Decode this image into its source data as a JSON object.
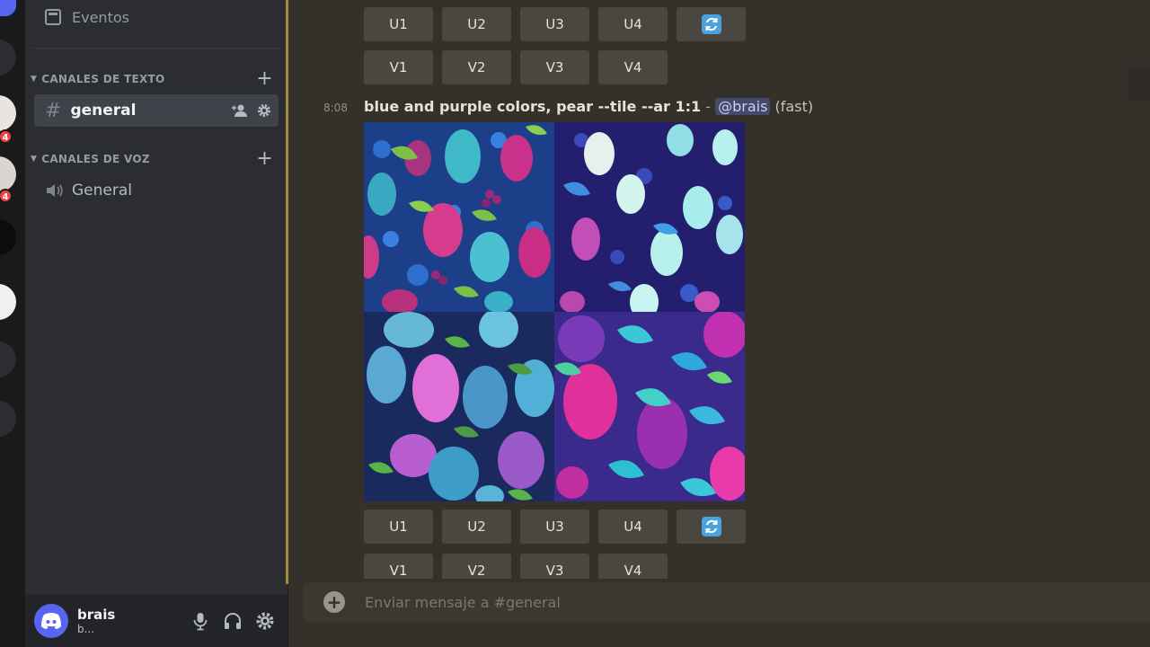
{
  "servers": {
    "badges": [
      "4",
      "4"
    ]
  },
  "sidebar": {
    "events_label": "Eventos",
    "text_category": "CANALES DE TEXTO",
    "voice_category": "CANALES DE VOZ",
    "text_channels": [
      {
        "name": "general",
        "selected": true
      }
    ],
    "voice_channels": [
      {
        "name": "General"
      }
    ]
  },
  "user": {
    "name": "brais",
    "status": "b..."
  },
  "chat": {
    "top_buttons": {
      "upscale": [
        "U1",
        "U2",
        "U3",
        "U4"
      ],
      "variation": [
        "V1",
        "V2",
        "V3",
        "V4"
      ]
    },
    "message": {
      "time": "8:08",
      "prompt": "blue and purple colors, pear --tile --ar 1:1",
      "separator": "-",
      "mention": "@brais",
      "mode": "(fast)"
    },
    "bottom_buttons": {
      "upscale": [
        "U1",
        "U2",
        "U3",
        "U4"
      ],
      "variation": [
        "V1",
        "V2",
        "V3",
        "V4"
      ]
    },
    "composer_placeholder": "Enviar mensaje a #general"
  },
  "colors": {
    "accent": "#5865f2",
    "separator": "#a48a3a",
    "refresh": "#5db8f0",
    "badge": "#f23f43"
  }
}
